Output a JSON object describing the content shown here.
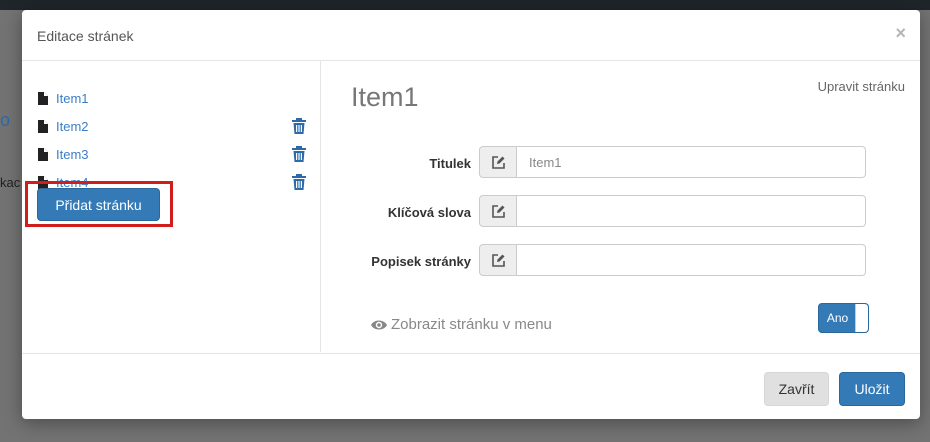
{
  "background": {
    "fragment_1": "o",
    "fragment_2": "kac"
  },
  "modal": {
    "title": "Editace stránek",
    "close_symbol": "×"
  },
  "sidebar": {
    "pages": [
      {
        "label": "Item1",
        "deletable": false
      },
      {
        "label": "Item2",
        "deletable": true
      },
      {
        "label": "Item3",
        "deletable": true
      },
      {
        "label": "Item4",
        "deletable": true
      }
    ],
    "add_label": "Přidat stránku"
  },
  "main": {
    "heading": "Item1",
    "edit_link": "Upravit stránku",
    "fields": {
      "title": {
        "label": "Titulek",
        "value": "Item1",
        "placeholder": ""
      },
      "keywords": {
        "label": "Klíčová slova",
        "value": "",
        "placeholder": ""
      },
      "description": {
        "label": "Popisek stránky",
        "value": "",
        "placeholder": ""
      }
    },
    "show_in_menu_label": "Zobrazit stránku v menu",
    "toggle_label": "Ano"
  },
  "footer": {
    "close_label": "Zavřít",
    "save_label": "Uložit"
  },
  "colors": {
    "primary": "#337ab7",
    "link": "#3a7dc9",
    "highlight": "#d21d1d"
  }
}
